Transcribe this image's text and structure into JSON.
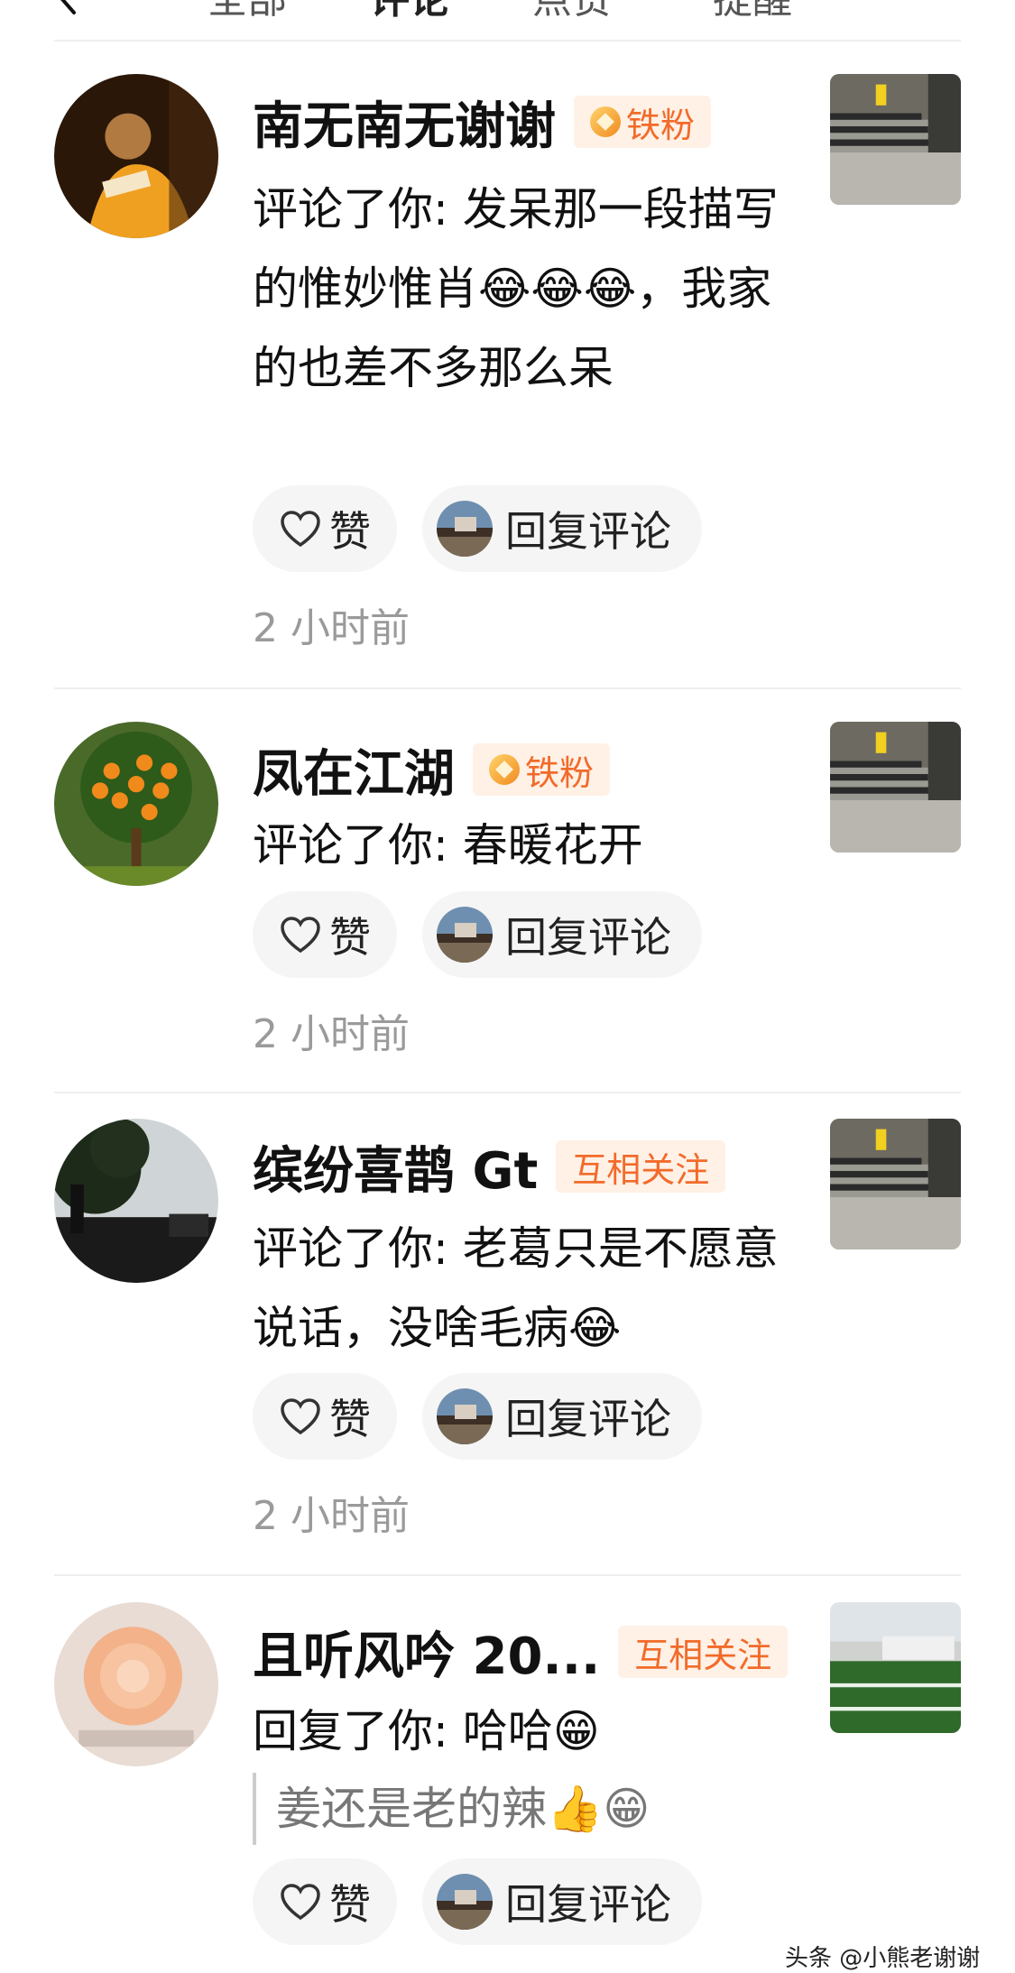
{
  "header": {
    "tabs": [
      "全部",
      "评论",
      "点赞",
      "提醒"
    ]
  },
  "colors": {
    "badge_bg": "#fff1e6",
    "badge_text": "#f26b2a",
    "pill_bg": "#f5f5f5",
    "time": "#9a9a9a"
  },
  "actions": {
    "like_label": "赞",
    "reply_label": "回复评论"
  },
  "items": [
    {
      "name": "南无南无谢谢",
      "badge": "铁粉",
      "comment": "评论了你: 发呆那一段描写的惟妙惟肖😂😂😂，我家的也差不多那么呆",
      "time": "2 小时前"
    },
    {
      "name": "凤在江湖",
      "badge": "铁粉",
      "comment": "评论了你: 春暖花开",
      "time": "2 小时前"
    },
    {
      "name": "缤纷喜鹊 Gt",
      "badge": "互相关注",
      "comment": "评论了你: 老葛只是不愿意说话，没啥毛病😂",
      "time": "2 小时前"
    },
    {
      "name": "且听风吟 20...",
      "badge": "互相关注",
      "comment": "回复了你: 哈哈😁",
      "quote": "姜还是老的辣👍😁",
      "time": ""
    }
  ],
  "watermark": "头条 @小熊老谢谢"
}
